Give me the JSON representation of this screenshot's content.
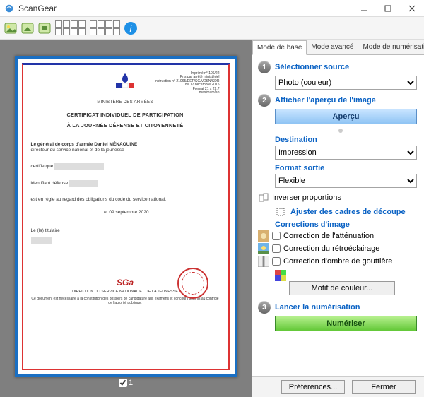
{
  "window": {
    "title": "ScanGear"
  },
  "tabs": {
    "basic": "Mode de base",
    "advanced": "Mode avancé",
    "auto": "Mode de numérisation automatique"
  },
  "step1": {
    "num": "1",
    "title": "Sélectionner source",
    "source": "Photo (couleur)"
  },
  "step2": {
    "num": "2",
    "title": "Afficher l'aperçu de l'image",
    "button": "Aperçu"
  },
  "dest": {
    "title": "Destination",
    "value": "Impression"
  },
  "format": {
    "title": "Format sortie",
    "value": "Flexible",
    "invert": "Inverser proportions"
  },
  "crop": {
    "title": "Ajuster des cadres de découpe"
  },
  "corrections": {
    "title": "Corrections d'image",
    "fade": "Correction de l'atténuation",
    "backlight": "Correction du rétroéclairage",
    "gutter": "Correction d'ombre de gouttière",
    "motif": "Motif de couleur..."
  },
  "step3": {
    "num": "3",
    "title": "Lancer la numérisation",
    "button": "Numériser"
  },
  "footer": {
    "prefs": "Préférences...",
    "close": "Fermer"
  },
  "frame": {
    "index": "1"
  },
  "doc": {
    "ministry": "MINISTÈRE DES ARMÉES",
    "cert1": "CERTIFICAT INDIVIDUEL DE PARTICIPATION",
    "cert2": "À LA JOURNÉE DÉFENSE ET CITOYENNETÉ",
    "general": "Le général de corps d'armée Daniel MÉNAOUINE",
    "director": "directeur du service national et de la jeunesse",
    "certify": "certifie que",
    "ident": "identifiant défense",
    "rule": "est en règle au regard des obligations du code du service national.",
    "date_label": "Le",
    "date": "09 septembre 2020",
    "holder": "Le (la) titulaire",
    "logo": "SGa",
    "direction": "DIRECTION DU SERVICE NATIONAL ET DE LA JEUNESSE",
    "note": "Ce document est nécessaire à la constitution des dossiers de candidature aux examens et concours soumis au contrôle de l'autorité publique."
  }
}
